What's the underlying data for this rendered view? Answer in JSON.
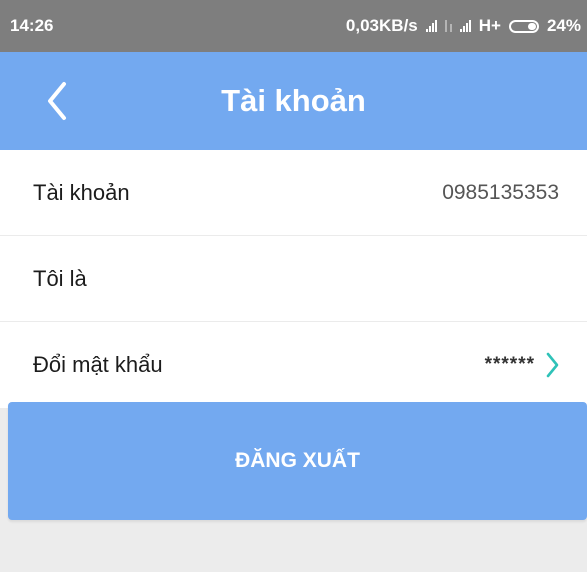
{
  "status_bar": {
    "time": "14:26",
    "network_speed": "0,03KB/s",
    "network_type": "H+",
    "battery": "24%"
  },
  "header": {
    "title": "Tài khoản",
    "back_icon": "chevron-left-icon"
  },
  "account_rows": [
    {
      "label": "Tài khoản",
      "value": "0985135353"
    },
    {
      "label": "Tôi là",
      "value": ""
    },
    {
      "label": "Đổi mật khẩu",
      "value": "******",
      "chevron_icon": "chevron-right-icon"
    }
  ],
  "logout_label": "ĐĂNG XUẤT",
  "colors": {
    "primary": "#73a9f0",
    "chevron": "#2fc2b8",
    "status_bar": "#7e7e7e",
    "background": "#ececec"
  }
}
